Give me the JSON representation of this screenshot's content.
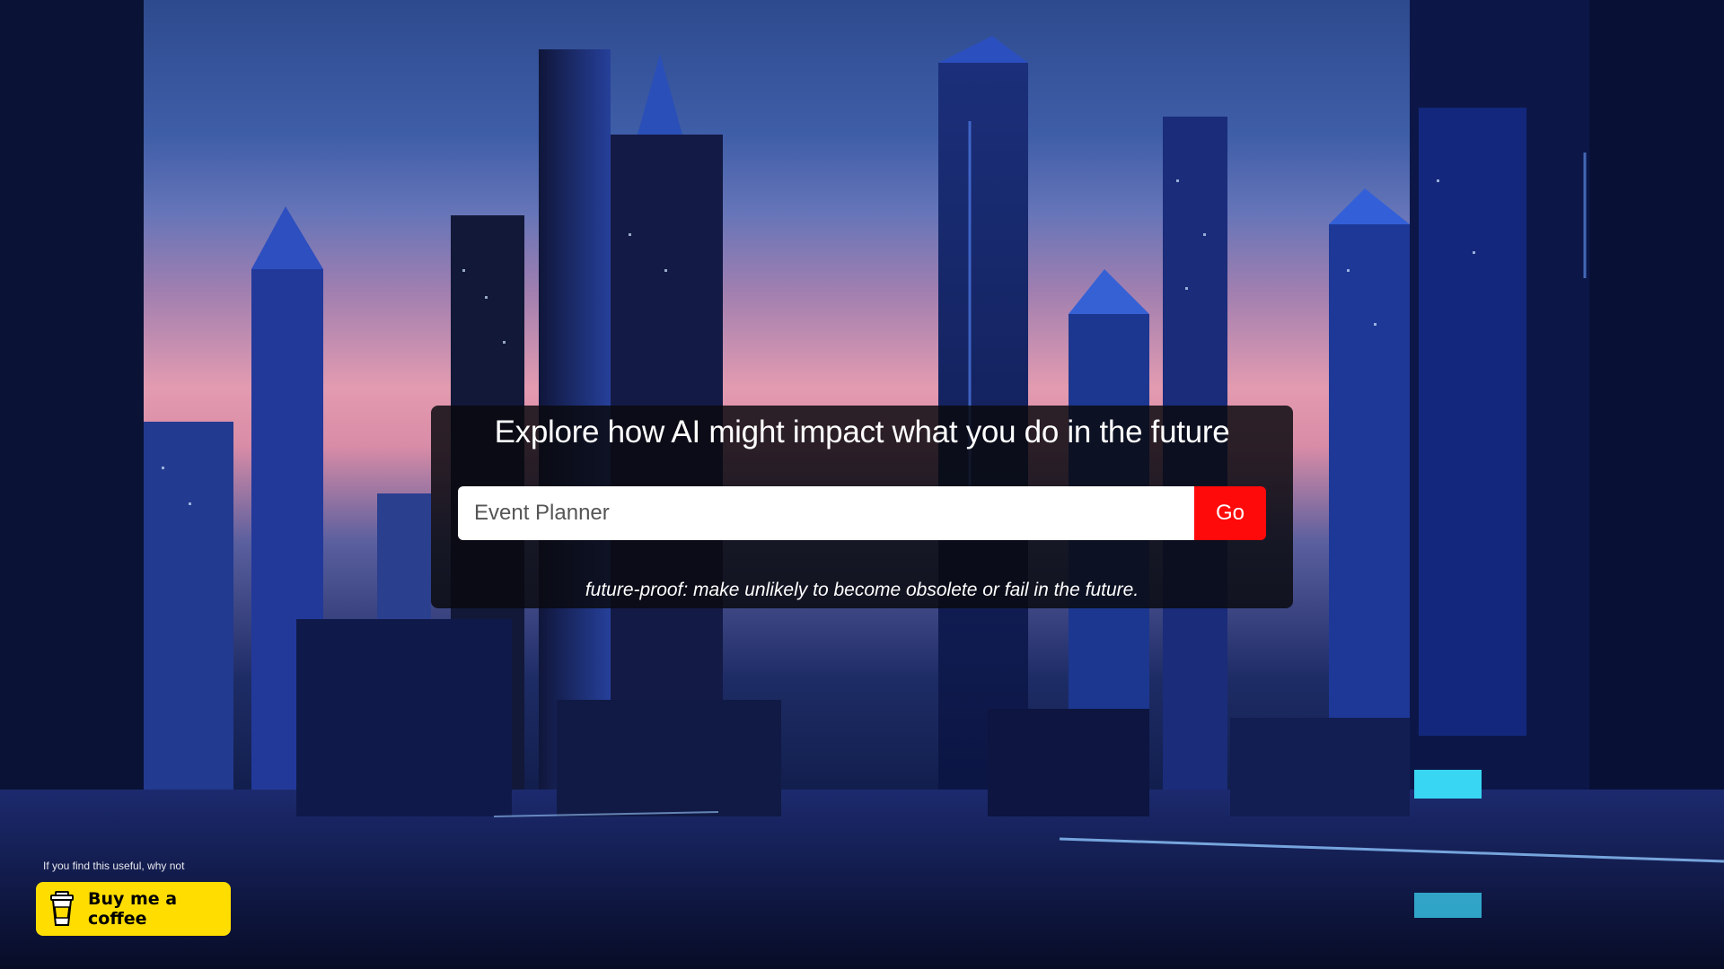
{
  "hero": {
    "title": "Explore how AI might impact what you do in the future",
    "search_value": "Event Planner",
    "go_label": "Go",
    "definition": "future-proof: make unlikely to become obsolete or fail in the future."
  },
  "support": {
    "note": "If you find this useful, why not",
    "button_label": "Buy me a coffee",
    "button_icon": "coffee-cup-icon"
  },
  "colors": {
    "go_button": "#ff0a0a",
    "coffee_button": "#ffdd00",
    "panel": "#0a0a0e"
  }
}
